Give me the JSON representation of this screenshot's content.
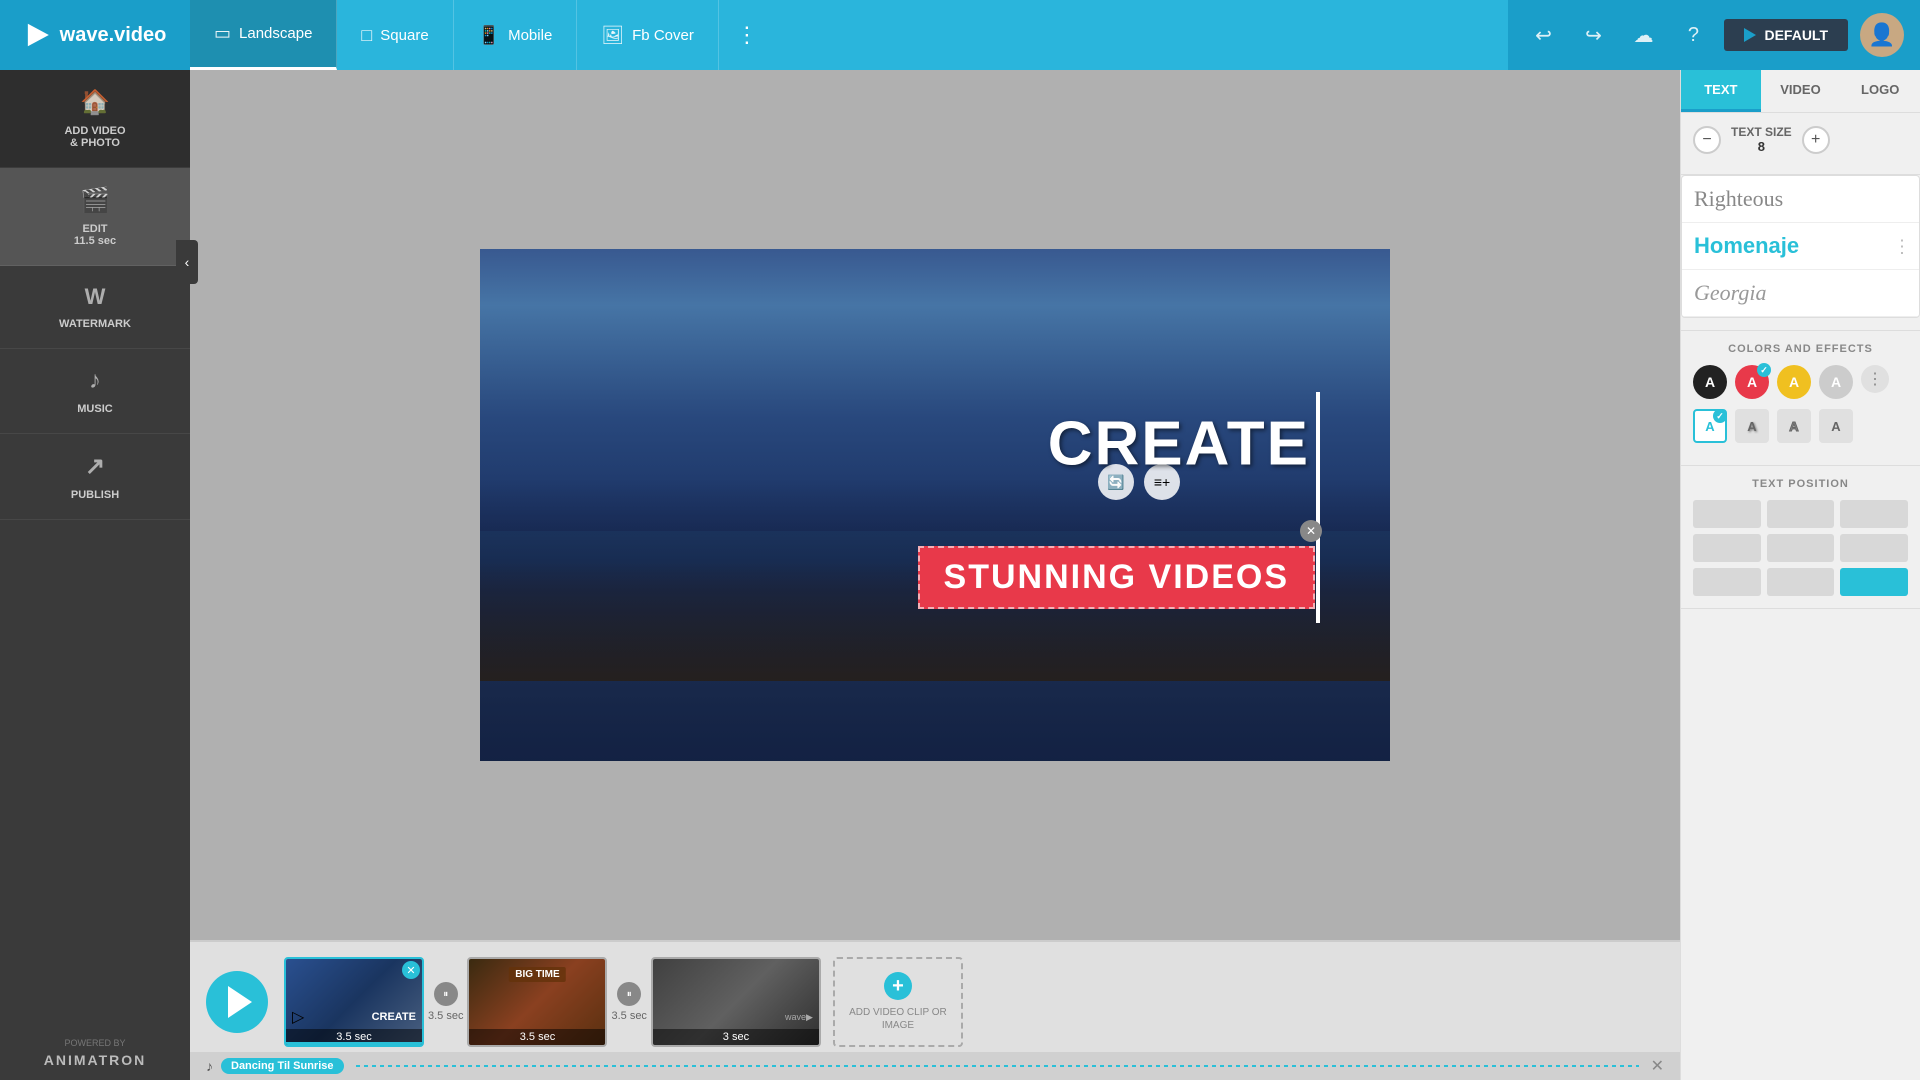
{
  "app": {
    "name": "wave.video"
  },
  "topbar": {
    "undo_label": "↩",
    "redo_label": "↪",
    "cloud_label": "☁",
    "help_label": "?",
    "default_label": "DEFAULT"
  },
  "format_tabs": [
    {
      "id": "landscape",
      "label": "Landscape",
      "icon": "▭",
      "ratio": "16:9",
      "active": true
    },
    {
      "id": "square",
      "label": "Square",
      "icon": "□"
    },
    {
      "id": "mobile",
      "label": "Mobile",
      "icon": "📱"
    },
    {
      "id": "fbcover",
      "label": "Fb Cover",
      "icon": "🖼"
    }
  ],
  "sidebar": {
    "items": [
      {
        "id": "add-video",
        "label": "ADD VIDEO\n& PHOTO",
        "icon": "🏠"
      },
      {
        "id": "edit",
        "label": "EDIT\n11.5 sec",
        "icon": "🎬"
      },
      {
        "id": "watermark",
        "label": "WATERMARK",
        "icon": "Ⓦ"
      },
      {
        "id": "music",
        "label": "MUSIC",
        "icon": "♪"
      },
      {
        "id": "publish",
        "label": "PUBLISH",
        "icon": "↗"
      }
    ],
    "powered_by": "POWERED BY",
    "brand": "ANIMATRON"
  },
  "canvas": {
    "text_create": "CREATE",
    "text_stunning": "STUNNING VIDEOS"
  },
  "timeline": {
    "clips": [
      {
        "id": "clip1",
        "duration": "3.5 sec",
        "label": "CREATE",
        "active": true
      },
      {
        "id": "clip2",
        "duration": "3.5 sec",
        "label": "BIG TIME"
      },
      {
        "id": "clip3",
        "duration": "3 sec",
        "label": ""
      }
    ],
    "add_clip_label": "ADD VIDEO CLIP OR IMAGE",
    "music_track": "Dancing Til Sunrise"
  },
  "right_panel": {
    "tabs": [
      {
        "id": "text",
        "label": "TEXT",
        "active": true
      },
      {
        "id": "video",
        "label": "VIDEO"
      },
      {
        "id": "logo",
        "label": "LOGO"
      }
    ],
    "text_size": {
      "label": "TEXT SIZE",
      "value": "8"
    },
    "fonts": [
      {
        "name": "Righteous",
        "style": "serif",
        "color": "#999999"
      },
      {
        "name": "Homenaje",
        "style": "sans",
        "color": "#29c0d8"
      },
      {
        "name": "Georgia",
        "style": "serif-italic",
        "color": "#aaaaaa"
      }
    ],
    "colors_label": "COLORS AND EFFECTS",
    "colors": [
      {
        "color": "#222222",
        "letter": "A",
        "selected": false
      },
      {
        "color": "#e8394a",
        "letter": "A",
        "selected": true
      },
      {
        "color": "#f0c020",
        "letter": "A",
        "selected": false
      },
      {
        "color": "#cccccc",
        "letter": "A",
        "selected": false
      }
    ],
    "effects": [
      {
        "label": "A",
        "style": "outline-blue",
        "selected": true
      },
      {
        "label": "A",
        "style": "shadow"
      },
      {
        "label": "A",
        "style": "outline"
      },
      {
        "label": "A",
        "style": "bold"
      }
    ],
    "position_label": "TEXT POSITION",
    "positions": [
      {
        "pos": "tl"
      },
      {
        "pos": "tc"
      },
      {
        "pos": "tr"
      },
      {
        "pos": "ml"
      },
      {
        "pos": "mc"
      },
      {
        "pos": "mr"
      },
      {
        "pos": "bl"
      },
      {
        "pos": "bc"
      },
      {
        "pos": "br",
        "active": true
      }
    ]
  }
}
